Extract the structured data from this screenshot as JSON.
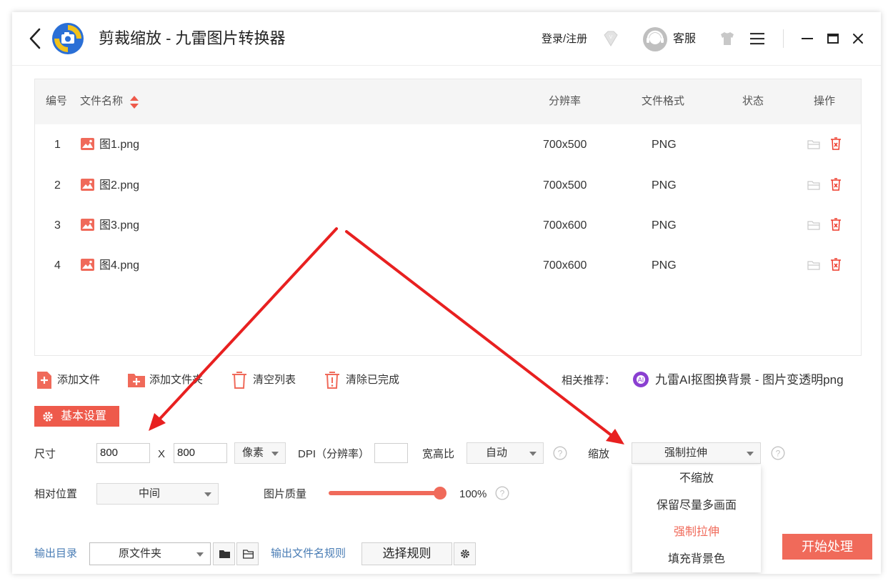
{
  "header": {
    "title": "剪裁缩放 - 九雷图片转换器",
    "login": "登录/注册",
    "service": "客服"
  },
  "table": {
    "headers": {
      "index": "编号",
      "filename": "文件名称",
      "resolution": "分辨率",
      "format": "文件格式",
      "status": "状态",
      "actions": "操作"
    },
    "rows": [
      {
        "index": "1",
        "name": "图1.png",
        "resolution": "700x500",
        "format": "PNG",
        "status": ""
      },
      {
        "index": "2",
        "name": "图2.png",
        "resolution": "700x500",
        "format": "PNG",
        "status": ""
      },
      {
        "index": "3",
        "name": "图3.png",
        "resolution": "700x600",
        "format": "PNG",
        "status": ""
      },
      {
        "index": "4",
        "name": "图4.png",
        "resolution": "700x600",
        "format": "PNG",
        "status": ""
      }
    ]
  },
  "toolbar": {
    "add_file": "添加文件",
    "add_folder": "添加文件夹",
    "clear_list": "清空列表",
    "clear_done": "清除已完成",
    "recommend_label": "相关推荐：",
    "recommend_link": "九雷AI抠图换背景 - 图片变透明png"
  },
  "settings": {
    "section_title": "基本设置",
    "size_label": "尺寸",
    "width": "800",
    "x_label": "X",
    "height": "800",
    "unit": "像素",
    "dpi_label": "DPI（分辨率）",
    "dpi_value": "",
    "aspect_label": "宽高比",
    "aspect_value": "自动",
    "scale_label": "缩放",
    "scale_value": "强制拉伸",
    "scale_options": [
      "不缩放",
      "保留尽量多画面",
      "强制拉伸",
      "填充背景色"
    ],
    "position_label": "相对位置",
    "position_value": "中间",
    "quality_label": "图片质量",
    "quality_value": "100%",
    "quality_level": 1.0
  },
  "output": {
    "dir_label": "输出目录",
    "dir_value": "原文件夹",
    "rule_label": "输出文件名规则",
    "rule_button": "选择规则",
    "start_button": "开始处理"
  },
  "colors": {
    "accent": "#ee5a4b",
    "arrow": "#e82020",
    "option_selected": "#f06a5a"
  }
}
